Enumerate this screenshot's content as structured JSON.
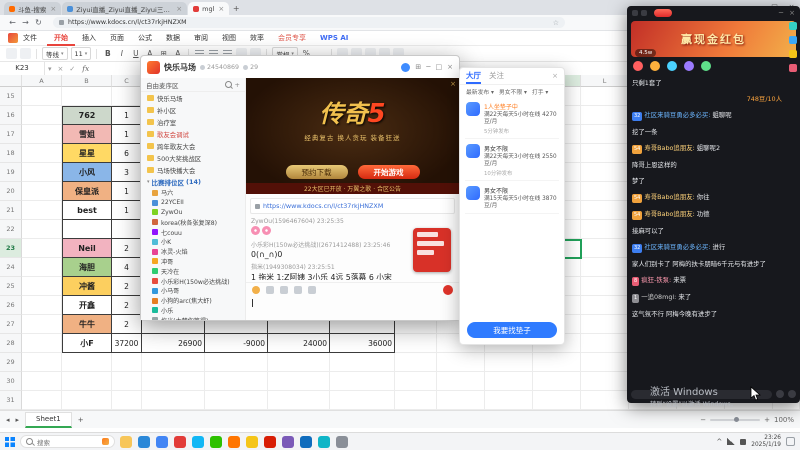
{
  "browser": {
    "active_tab": 2,
    "tabs": [
      {
        "label": "斗鱼-搜索"
      },
      {
        "label": "Ziyui直播_Ziyui直播_Ziyui三周…"
      },
      {
        "label": "mgl"
      }
    ],
    "url": "https://www.kdocs.cn/l/ct37rkjHNZXM"
  },
  "wps": {
    "file_menu": "文件",
    "menus": [
      {
        "label": "开始",
        "state": "active"
      },
      {
        "label": "插入"
      },
      {
        "label": "页面"
      },
      {
        "label": "公式"
      },
      {
        "label": "数据"
      },
      {
        "label": "审阅"
      },
      {
        "label": "视图"
      },
      {
        "label": "效率"
      },
      {
        "label": "会员专享",
        "state": "vip"
      },
      {
        "label": "WPS AI",
        "state": "ai"
      }
    ],
    "font_name": "等线",
    "font_size": "11",
    "number_format": "常规",
    "name_box": "K23",
    "sheet_tab": "Sheet1",
    "zoom": "100%"
  },
  "sheet": {
    "columns": [
      "A",
      "B",
      "C",
      "D",
      "E",
      "F",
      "G",
      "H",
      "I",
      "J",
      "K",
      "L",
      "M",
      "N",
      "O",
      "P"
    ],
    "selected_cell": "K23",
    "rows": [
      {
        "n": 15,
        "t": false
      },
      {
        "n": 16,
        "b": "762",
        "c": "1",
        "fill": "#cdd8cb",
        "t": true
      },
      {
        "n": 17,
        "b": "雪姐",
        "c": "1",
        "fill": "#f2b9b4",
        "t": true
      },
      {
        "n": 18,
        "b": "星星",
        "c": "6",
        "fill": "#ffd964",
        "t": true
      },
      {
        "n": 19,
        "b": "小风",
        "c": "3",
        "fill": "#8ab6e8",
        "t": true
      },
      {
        "n": 20,
        "b": "保皇派",
        "c": "1",
        "fill": "#f0b183",
        "t": true
      },
      {
        "n": 21,
        "b": "best",
        "c": "1",
        "fill": "#ffffff",
        "t": true
      },
      {
        "n": 22,
        "t": true
      },
      {
        "n": 23,
        "b": "Neil",
        "c": "2",
        "fill": "#f2b3c0",
        "t": true
      },
      {
        "n": 24,
        "b": "海胆",
        "c": "4",
        "fill": "#a8d08d",
        "t": true
      },
      {
        "n": 25,
        "b": "冲酱",
        "c": "2",
        "fill": "#fccf5f",
        "t": true
      },
      {
        "n": 26,
        "b": "开鑫",
        "c": "2",
        "fill": "#ffffff",
        "t": true
      },
      {
        "n": 27,
        "b": "牛牛",
        "c": "2",
        "fill": "#f0b183",
        "t": true
      },
      {
        "n": 28,
        "b": "小F",
        "c": "37200",
        "d": "26900",
        "e": "-9000",
        "f": "24000",
        "g": "36000",
        "fill": "#ffffff",
        "t": true
      },
      {
        "n": 29,
        "t": false
      },
      {
        "n": 30,
        "t": false
      },
      {
        "n": 31,
        "t": false
      }
    ]
  },
  "chat": {
    "title": "快乐马场",
    "room_id": "24540869",
    "online": "29",
    "panel_header": "自由麦序区",
    "tree": [
      {
        "label": "快乐马场"
      },
      {
        "label": "补小区"
      },
      {
        "label": "治疗室"
      },
      {
        "label": "歌友会调试",
        "color": "#d0453e"
      },
      {
        "label": "跨年歌友大会"
      },
      {
        "label": "500大奖挑战区"
      },
      {
        "label": "马场快播大会"
      }
    ],
    "group_label": "比赛排位区",
    "group_count": "(14)",
    "members": [
      {
        "name": "马六",
        "color": "#e8a33d"
      },
      {
        "name": "22YCEII",
        "color": "#4a90d9"
      },
      {
        "name": "ZywOu",
        "color": "#7ed321"
      },
      {
        "name": "korea(秋各张复深8)",
        "color": "#d0653e"
      },
      {
        "name": "七couu",
        "color": "#9013fe"
      },
      {
        "name": "小K",
        "color": "#50bcd8"
      },
      {
        "name": "冰灵-火焰",
        "color": "#e84393"
      },
      {
        "name": "冲哥",
        "color": "#f5a623"
      },
      {
        "name": "天冷在",
        "color": "#2ecc71"
      },
      {
        "name": "小乐彩H(150w必达挑战)",
        "color": "#e74c3c"
      },
      {
        "name": "小马哥",
        "color": "#3498db"
      },
      {
        "name": "小狗的arc(焦大虾)",
        "color": "#e67e22"
      },
      {
        "name": "小乐",
        "color": "#1abc9c"
      },
      {
        "name": "拖米(太梦你等得)",
        "color": "#95a5a6"
      }
    ],
    "ad": {
      "title_main": "传奇",
      "title_num": "5",
      "slogan": "经典复古 换人贪玩 装备狂送",
      "btn_secondary": "预约下载",
      "btn_primary": "开始游戏",
      "footer": "22大区已开放 · 万翼之歌 · 合区公告"
    },
    "pinned_link": "https://www.kdocs.cn/l/ct37rkjHNZXM",
    "messages": [
      {
        "header": "ZywOu(1596467604) 23:25:35",
        "body": "",
        "kind": "emoji"
      },
      {
        "header": "小乐彩H(150w必达挑战)(2671412488) 23:25:46",
        "body": "0(∩_∩)0",
        "kind": "text"
      },
      {
        "header": "指米(1949308034) 23:25:51",
        "body": "1 拖米 1:Z阿姨 3小乐 4远 5落幕 6 小宋",
        "kind": "text"
      }
    ]
  },
  "lobby": {
    "tabs": [
      {
        "label": "大厅",
        "active": true
      },
      {
        "label": "关注",
        "active": false
      }
    ],
    "filters": [
      "最新发布",
      "男女不限",
      "打手"
    ],
    "cards": [
      {
        "status": "1人坐垫子中",
        "desc": "满22天每天5小时在线 4270豆/月",
        "meta": "5分钟发布"
      },
      {
        "status": "男女不限",
        "desc": "满22天每天3小时在线 2550豆/月",
        "meta": "10分钟发布"
      },
      {
        "status": "男女不限",
        "desc": "满15天每天5小时在线 3870豆/月",
        "meta": ""
      }
    ],
    "cta": "我要找垫子"
  },
  "assistant": {
    "banner_title": "赢现金红包",
    "viewers": "4.5w",
    "messages": [
      {
        "text": "只剩1套了"
      },
      {
        "meta": "748豆/10人"
      },
      {
        "badge": "32",
        "badge_color": "#3d7ef0",
        "name": "社区来骑豆勇必多必买",
        "name_color": "#6cb6ff",
        "text": "蛆聊呢"
      },
      {
        "text": "挖了一条"
      },
      {
        "badge": "54",
        "badge_color": "#f0a23d",
        "name": "寿哥Babo追朋友",
        "name_color": "#ffd37a",
        "text": "蛆聊呢2"
      },
      {
        "text": "降哥上恩这样的"
      },
      {
        "text": "梦了"
      },
      {
        "badge": "54",
        "badge_color": "#f0a23d",
        "name": "寿哥Babo追朋友",
        "name_color": "#ffd37a",
        "text": "你往"
      },
      {
        "badge": "54",
        "badge_color": "#f0a23d",
        "name": "寿哥Babo追朋友",
        "name_color": "#ffd37a",
        "text": "功德"
      },
      {
        "text": "接麻可以了"
      },
      {
        "badge": "32",
        "badge_color": "#3d7ef0",
        "name": "社区来骑豆勇必多必买",
        "name_color": "#6cb6ff",
        "text": "进行"
      },
      {
        "text": "家人们别卡了 阿梅的扶卡朋暗6千元与有进步了"
      },
      {
        "badge": "8",
        "badge_color": "#e85d75",
        "name": "疯狂-铁泵",
        "name_color": "#ff9bb0",
        "text": "来票"
      },
      {
        "badge": "1",
        "badge_color": "#8e8e93",
        "name": "一追08mgl",
        "name_color": "#cfcfcf",
        "text": "来了"
      },
      {
        "text": "这气氛不行 阿梅今晚有进步了"
      }
    ]
  },
  "watermark": {
    "line1": "激活 Windows",
    "line2": "转到“设置”以激活 Windows。"
  },
  "taskbar": {
    "search": "搜索",
    "time": "23:26",
    "date": "2025/1/19",
    "apps": [
      {
        "name": "file-explorer",
        "color": "#f7c65a"
      },
      {
        "name": "edge-browser",
        "color": "#2b88d8"
      },
      {
        "name": "chrome-browser",
        "color": "#4285f4"
      },
      {
        "name": "wps-office",
        "color": "#e23c39"
      },
      {
        "name": "qq",
        "color": "#12b7f5"
      },
      {
        "name": "wechat",
        "color": "#2dc100"
      },
      {
        "name": "douyu",
        "color": "#ff7500"
      },
      {
        "name": "yy-voice",
        "color": "#f5c518"
      },
      {
        "name": "music-player",
        "color": "#d81e06"
      },
      {
        "name": "game-center",
        "color": "#7b5ab8"
      },
      {
        "name": "mail",
        "color": "#0f6cbd"
      },
      {
        "name": "store",
        "color": "#0fb5c7"
      },
      {
        "name": "settings",
        "color": "#8a8f98"
      }
    ]
  }
}
